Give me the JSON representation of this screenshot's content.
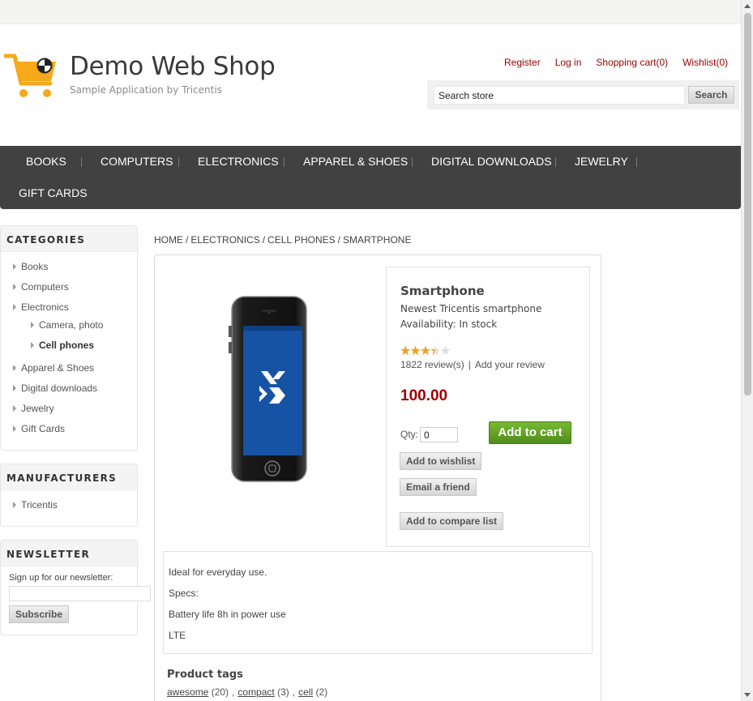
{
  "header": {
    "title": "Demo Web Shop",
    "subtitle": "Sample Application by Tricentis",
    "links": [
      "Register",
      "Log in",
      "Shopping cart(0)",
      "Wishlist(0)"
    ],
    "search_placeholder": "Search store",
    "search_button": "Search",
    "link_color": "#990000"
  },
  "menu": {
    "items": [
      "BOOKS",
      "COMPUTERS",
      "ELECTRONICS",
      "APPAREL & SHOES",
      "DIGITAL DOWNLOADS",
      "JEWELRY",
      "GIFT CARDS"
    ],
    "background": "#414141"
  },
  "sidebar": {
    "categories_title": "CATEGORIES",
    "categories": [
      "Books",
      "Computers",
      "Electronics",
      "Camera, photo",
      "Cell phones",
      "Apparel & Shoes",
      "Digital downloads",
      "Jewelry",
      "Gift Cards"
    ],
    "manufacturers_title": "MANUFACTURERS",
    "manufacturers": [
      "Tricentis"
    ],
    "newsletter_title": "NEWSLETTER",
    "newsletter_label": "Sign up for our newsletter:",
    "subscribe_button": "Subscribe"
  },
  "breadcrumb": [
    "HOME",
    "ELECTRONICS",
    "CELL PHONES",
    "SMARTPHONE"
  ],
  "product": {
    "name": "Smartphone",
    "short_description": "Newest Tricentis smartphone",
    "availability": "Availability: In stock",
    "rating_stars": 3.5,
    "rating_max": 5,
    "reviews_link": "1822 review(s)",
    "add_review_link": "Add your review",
    "price": "100.00",
    "qty_label": "Qty:",
    "qty_value": "0",
    "add_to_cart": "Add to cart",
    "add_to_wishlist": "Add to wishlist",
    "email_friend": "Email a friend",
    "add_to_compare": "Add to compare list",
    "image_icon": "smartphone-image",
    "price_color": "#a10000",
    "cart_button_color": "#5a9a20"
  },
  "description": {
    "lines": [
      "Ideal for everyday use.",
      "Specs:",
      "Battery life 8h in power use",
      "LTE"
    ]
  },
  "tags": {
    "title": "Product tags",
    "items": [
      {
        "name": "awesome",
        "count": "(20)"
      },
      {
        "name": "compact",
        "count": "(3)"
      },
      {
        "name": "cell",
        "count": "(2)"
      }
    ]
  }
}
